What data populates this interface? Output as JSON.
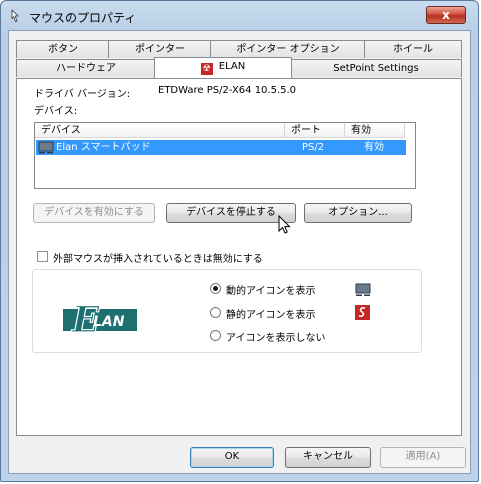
{
  "window": {
    "title": "マウスのプロパティ",
    "close_symbol": "x"
  },
  "tabs_row1": [
    "ボタン",
    "ポインター",
    "ポインター オプション",
    "ホイール"
  ],
  "tabs_row2": [
    "ハードウェア",
    "ELAN",
    "SetPoint Settings"
  ],
  "active_tab": "ELAN",
  "elan_tab_icon": "elan-logo-icon",
  "driver": {
    "label": "ドライバ バージョン:",
    "value": "ETDWare PS/2-X64 10.5.5.0"
  },
  "devices": {
    "label": "デバイス:",
    "columns": [
      "デバイス",
      "ポート",
      "有効"
    ],
    "rows": [
      {
        "name": "Elan スマートパッド",
        "port": "PS/2",
        "enabled": "有効",
        "selected": true
      }
    ]
  },
  "buttons": {
    "enable": "デバイスを有効にする",
    "disable": "デバイスを停止する",
    "options": "オプション..."
  },
  "disable_on_external_mouse": {
    "label": "外部マウスが挿入されているときは無効にする",
    "checked": false
  },
  "tray_icon": {
    "logo_text": "LAN",
    "logo_letter": "E",
    "options": [
      {
        "label": "動的アイコンを表示",
        "checked": true,
        "icon": "touchpad-icon"
      },
      {
        "label": "静的アイコンを表示",
        "checked": false,
        "icon": "elan-red-icon"
      },
      {
        "label": "アイコンを表示しない",
        "checked": false,
        "icon": ""
      }
    ]
  },
  "footer": {
    "ok": "OK",
    "cancel": "キャンセル",
    "apply": "適用(A)"
  },
  "colors": {
    "selection": "#3399ff",
    "elan_green": "#1e6f6f",
    "elan_red": "#c62828"
  }
}
